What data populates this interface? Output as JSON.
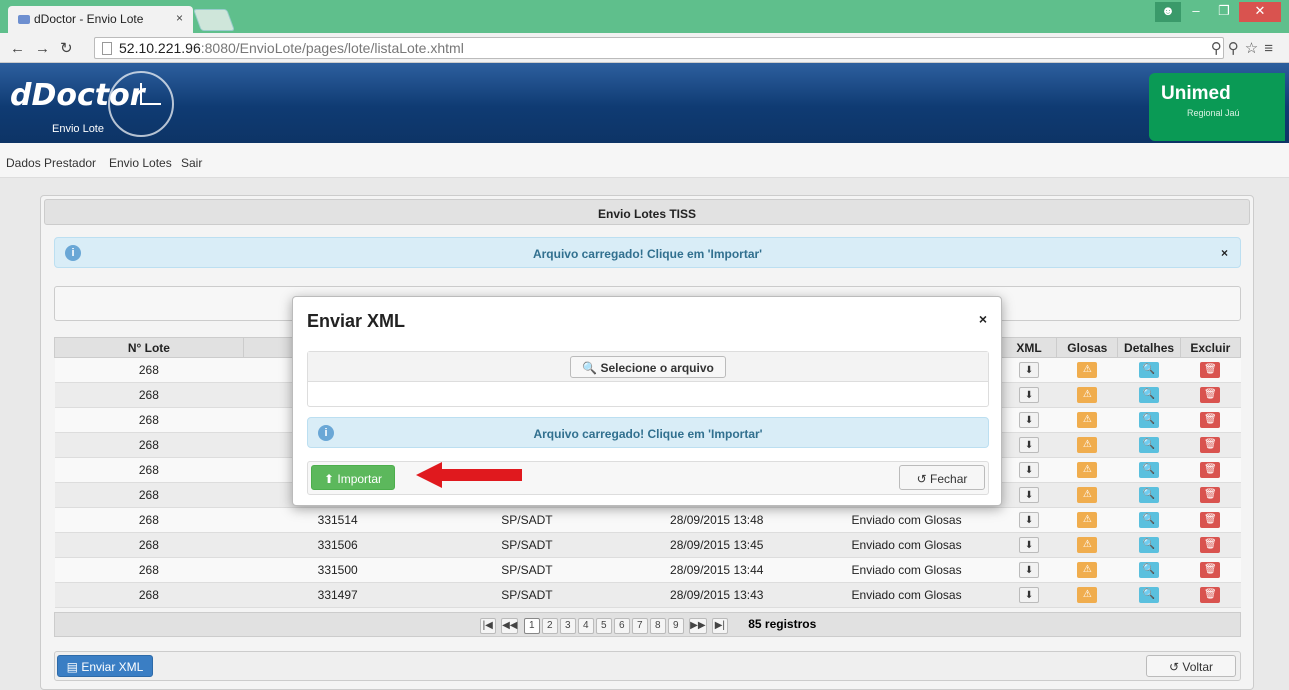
{
  "browser": {
    "tab_title": "dDoctor - Envio Lote",
    "tab_close": "×",
    "url_host": "52.10.221.96",
    "url_path": ":8080/EnvioLote/pages/lote/listaLote.xhtml"
  },
  "header": {
    "logo": "dDoctor",
    "logo_sub": "Envio Lote",
    "brand": "Unimed",
    "brand_sub": "Regional Jaú"
  },
  "menu": [
    "Dados Prestador",
    "Envio Lotes",
    "Sair"
  ],
  "panel": {
    "title": "Envio Lotes TISS",
    "message": "Arquivo carregado! Clique em 'Importar'",
    "message_close": "×"
  },
  "table": {
    "headers": [
      "N° Lote",
      "",
      "",
      "",
      "",
      "XML",
      "Glosas",
      "Detalhes",
      "Excluir"
    ],
    "rows": [
      {
        "lote": "268",
        "num": "",
        "tipo": "",
        "data": "",
        "status": ""
      },
      {
        "lote": "268",
        "num": "",
        "tipo": "",
        "data": "",
        "status": ""
      },
      {
        "lote": "268",
        "num": "",
        "tipo": "",
        "data": "",
        "status": ""
      },
      {
        "lote": "268",
        "num": "",
        "tipo": "",
        "data": "",
        "status": ""
      },
      {
        "lote": "268",
        "num": "",
        "tipo": "",
        "data": "",
        "status": ""
      },
      {
        "lote": "268",
        "num": "",
        "tipo": "",
        "data": "",
        "status": ""
      },
      {
        "lote": "268",
        "num": "331514",
        "tipo": "SP/SADT",
        "data": "28/09/2015 13:48",
        "status": "Enviado com Glosas"
      },
      {
        "lote": "268",
        "num": "331506",
        "tipo": "SP/SADT",
        "data": "28/09/2015 13:45",
        "status": "Enviado com Glosas"
      },
      {
        "lote": "268",
        "num": "331500",
        "tipo": "SP/SADT",
        "data": "28/09/2015 13:44",
        "status": "Enviado com Glosas"
      },
      {
        "lote": "268",
        "num": "331497",
        "tipo": "SP/SADT",
        "data": "28/09/2015 13:43",
        "status": "Enviado com Glosas"
      }
    ]
  },
  "pager": {
    "pages": [
      "1",
      "2",
      "3",
      "4",
      "5",
      "6",
      "7",
      "8",
      "9"
    ],
    "total": "85 registros"
  },
  "footer": {
    "enviar": "Enviar XML",
    "voltar": "Voltar"
  },
  "dialog": {
    "title": "Enviar XML",
    "close": "×",
    "select": "Selecione o arquivo",
    "message": "Arquivo carregado! Clique em 'Importar'",
    "importar": "Importar",
    "fechar": "Fechar"
  },
  "colors": {
    "header": "#0f3b73",
    "unimed": "#0a9a55",
    "info_bg": "#d9edf7",
    "importar": "#5cb85c",
    "arrow": "#e0191e"
  }
}
